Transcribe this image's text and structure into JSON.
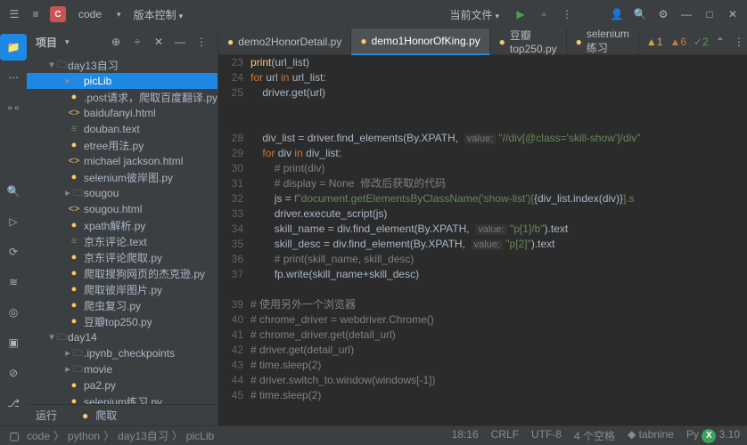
{
  "titlebar": {
    "logo": "C",
    "project": "code",
    "menu_vcs": "版本控制",
    "current_file": "当前文件",
    "icons": [
      "person-add",
      "search",
      "gear",
      "minimize",
      "maximize",
      "close"
    ]
  },
  "sidebar": {
    "title": "项目",
    "tree": [
      {
        "t": "folder",
        "l": "day13自习",
        "ind": 1,
        "exp": true
      },
      {
        "t": "folder",
        "l": "picLib",
        "ind": 2,
        "sel": true
      },
      {
        "t": "py",
        "l": ".post请求，爬取百度翻译.py",
        "ind": 2
      },
      {
        "t": "html",
        "l": "baidufanyi.html",
        "ind": 2
      },
      {
        "t": "txt",
        "l": "douban.text",
        "ind": 2
      },
      {
        "t": "py",
        "l": "etree用法.py",
        "ind": 2
      },
      {
        "t": "html",
        "l": "michael jackson.html",
        "ind": 2
      },
      {
        "t": "py",
        "l": "selenium彼岸图.py",
        "ind": 2
      },
      {
        "t": "folder",
        "l": "sougou",
        "ind": 2
      },
      {
        "t": "html",
        "l": "sougou.html",
        "ind": 2
      },
      {
        "t": "py",
        "l": "xpath解析.py",
        "ind": 2
      },
      {
        "t": "txt",
        "l": "京东评论.text",
        "ind": 2
      },
      {
        "t": "py",
        "l": "京东评论爬取.py",
        "ind": 2
      },
      {
        "t": "py",
        "l": "爬取搜狗网页的杰克逊.py",
        "ind": 2
      },
      {
        "t": "py",
        "l": "爬取彼岸图片.py",
        "ind": 2
      },
      {
        "t": "py",
        "l": "爬虫复习.py",
        "ind": 2
      },
      {
        "t": "py",
        "l": "豆瓣top250.py",
        "ind": 2
      },
      {
        "t": "folder",
        "l": "day14",
        "ind": 1,
        "exp": true
      },
      {
        "t": "folder",
        "l": ".ipynb_checkpoints",
        "ind": 2
      },
      {
        "t": "folder",
        "l": "movie",
        "ind": 2
      },
      {
        "t": "py",
        "l": "pa2.py",
        "ind": 2
      },
      {
        "t": "py",
        "l": "selenium练习.py",
        "ind": 2
      }
    ],
    "run": "运行",
    "run_target": "爬取"
  },
  "tabs": {
    "items": [
      {
        "l": "demo2HonorDetail.py"
      },
      {
        "l": "demo1HonorOfKing.py",
        "active": true
      },
      {
        "l": "豆瓣top250.py"
      },
      {
        "l": "selenium练习"
      }
    ],
    "badges": {
      "warn": "1",
      "tri": "6",
      "chk": "2"
    }
  },
  "code": {
    "start": 23,
    "lines": [
      {
        "n": 23,
        "h": "<span class='fn'>print</span>(url_list)"
      },
      {
        "n": 24,
        "h": "<span class='kw'>for</span> url <span class='kw'>in</span> url_list:"
      },
      {
        "n": 25,
        "h": "    driver.get(url)"
      },
      {
        "n": "",
        "h": ""
      },
      {
        "n": "",
        "h": ""
      },
      {
        "n": 28,
        "h": "    div_list = driver.find_elements(By.XPATH,  <span class='hint'>value:</span> <span class='str'>\"//div[@class='skill-show']/div\"</span>"
      },
      {
        "n": 29,
        "h": "    <span class='kw'>for</span> div <span class='kw'>in</span> div_list:"
      },
      {
        "n": 30,
        "h": "        <span class='cm'># print(div)</span>"
      },
      {
        "n": 31,
        "h": "        <span class='cm'># display = None  修改后获取的代码</span>"
      },
      {
        "n": 32,
        "h": "        js = <span class='str'>f\"document.getElementsByClassName('show-list')[</span>{div_list.index(div)}<span class='str'>].s</span>"
      },
      {
        "n": 33,
        "h": "        driver.execute_script(js)"
      },
      {
        "n": 34,
        "h": "        skill_name = div.find_element(By.XPATH,  <span class='hint'>value:</span> <span class='str'>\"p[1]/b\"</span>).text"
      },
      {
        "n": 35,
        "h": "        skill_desc = div.find_element(By.XPATH,  <span class='hint'>value:</span> <span class='str'>\"p[2]\"</span>).text"
      },
      {
        "n": 36,
        "h": "        <span class='cm'># print(skill_name, skill_desc)</span>"
      },
      {
        "n": 37,
        "h": "        fp.write(skill_name+skill_desc)"
      },
      {
        "n": "",
        "h": ""
      },
      {
        "n": 39,
        "h": "<span class='cm'># 使用另外一个浏览器</span>"
      },
      {
        "n": 40,
        "h": "<span class='cm'># chrome_driver = webdriver.Chrome()</span>"
      },
      {
        "n": 41,
        "h": "<span class='cm'># chrome_driver.get(detail_url)</span>"
      },
      {
        "n": 42,
        "h": "<span class='cm'># driver.get(detail_url)</span>"
      },
      {
        "n": 43,
        "h": "<span class='cm'># time.sleep(2)</span>"
      },
      {
        "n": 44,
        "h": "<span class='cm'># driver.switch_to.window(windows[-1])</span>"
      },
      {
        "n": 45,
        "h": "<span class='cm'># time.sleep(2)</span>"
      }
    ]
  },
  "status": {
    "crumbs": [
      "code",
      "python",
      "day13自习",
      "picLib"
    ],
    "pos": "18:16",
    "enc": "CRLF",
    "charset": "UTF-8",
    "spaces": "4 个空格",
    "py": "Py",
    "ver": "3.10",
    "tabnine": "tabnine"
  }
}
